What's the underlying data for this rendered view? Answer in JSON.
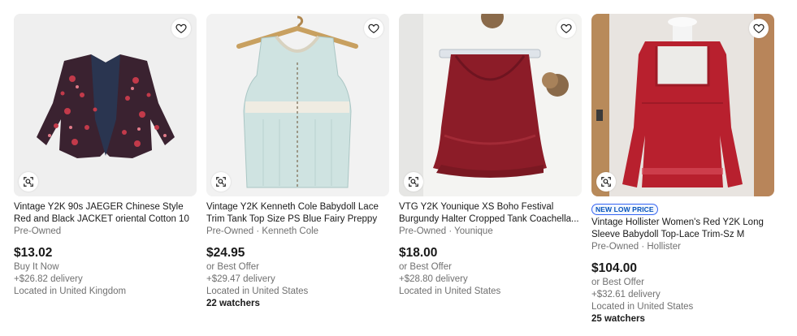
{
  "listings": [
    {
      "title": "Vintage Y2K 90s JAEGER Chinese Style Red and Black JACKET oriental Cotton 10",
      "subtitle": "Pre-Owned",
      "price": "$13.02",
      "purchase": "Buy It Now",
      "delivery": "+$26.82 delivery",
      "location": "Located in United Kingdom",
      "watchers": "",
      "badge": ""
    },
    {
      "title": "Vintage Y2K Kenneth Cole Babydoll Lace Trim Tank Top Size PS Blue Fairy Preppy",
      "subtitle": "Pre-Owned · Kenneth Cole",
      "price": "$24.95",
      "purchase": "or Best Offer",
      "delivery": "+$29.47 delivery",
      "location": "Located in United States",
      "watchers": "22 watchers",
      "badge": ""
    },
    {
      "title": "VTG Y2K Younique XS Boho Festival Burgundy Halter Cropped Tank Coachella...",
      "subtitle": "Pre-Owned · Younique",
      "price": "$18.00",
      "purchase": "or Best Offer",
      "delivery": "+$28.80 delivery",
      "location": "Located in United States",
      "watchers": "",
      "badge": ""
    },
    {
      "title": "Vintage Hollister Women's Red Y2K Long Sleeve Babydoll Top-Lace Trim-Sz M",
      "subtitle": "Pre-Owned · Hollister",
      "price": "$104.00",
      "purchase": "or Best Offer",
      "delivery": "+$32.61 delivery",
      "location": "Located in United States",
      "watchers": "25 watchers",
      "badge": "NEW LOW PRICE"
    }
  ],
  "icons": {
    "favorite": "heart-outline-icon",
    "visual_search": "image-search-icon"
  },
  "colors": {
    "text": "#191919",
    "secondary_text": "#707070",
    "badge_blue": "#3665f3"
  }
}
